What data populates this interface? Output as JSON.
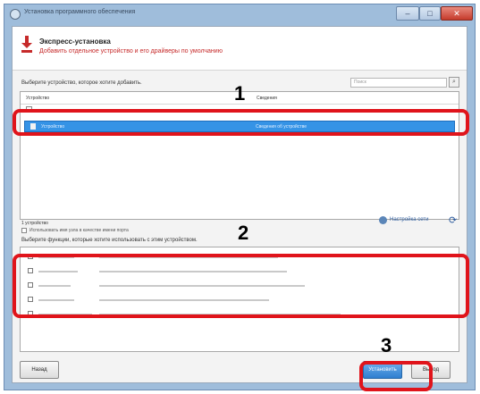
{
  "window": {
    "title": "Установка программного обеспечения",
    "min_glyph": "–",
    "max_glyph": "□",
    "close_glyph": "✕"
  },
  "header": {
    "title": "Экспресс-установка",
    "subtitle": "Добавить отдельное устройство и его драйверы по умолчанию"
  },
  "devices": {
    "label": "Выберите устройство, которое хотите добавить.",
    "search_placeholder": "Поиск",
    "search_icon": "search-icon",
    "columns": [
      "Устройство",
      "Сведения"
    ],
    "selected_row": {
      "name": "Устройство",
      "details": "Сведения об устройстве"
    },
    "count": "1 устройство",
    "port_option": "Использовать имя узла в качестве имени порта",
    "network_settings": "Настройка сети",
    "refresh_icon": "refresh-icon",
    "refresh_glyph": "⟳"
  },
  "functions": {
    "label": "Выберите функции, которые хотите использовать с этим устройством."
  },
  "buttons": {
    "back": "Назад",
    "install": "Установить",
    "cancel": "Выход"
  },
  "callouts": [
    "1",
    "2",
    "3"
  ],
  "colors": {
    "accent": "#3593e6",
    "highlight": "#e0141b",
    "subtitle": "#c62a2a"
  }
}
